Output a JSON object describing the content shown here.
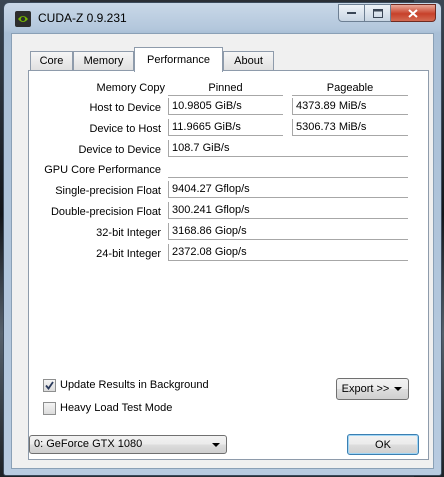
{
  "window": {
    "title": "CUDA-Z 0.9.231"
  },
  "tabs": [
    {
      "label": "Core"
    },
    {
      "label": "Memory"
    },
    {
      "label": "Performance"
    },
    {
      "label": "About"
    }
  ],
  "active_tab": "Performance",
  "memory": {
    "section_label": "Memory Copy",
    "col_pinned": "Pinned",
    "col_pageable": "Pageable",
    "rows": [
      {
        "label": "Host to Device",
        "pinned": "10.9805 GiB/s",
        "pageable": "4373.89 MiB/s"
      },
      {
        "label": "Device to Host",
        "pinned": "11.9665 GiB/s",
        "pageable": "5306.73 MiB/s"
      },
      {
        "label": "Device to Device",
        "pinned": "108.7 GiB/s"
      }
    ]
  },
  "gpu": {
    "section_label": "GPU Core Performance",
    "rows": [
      {
        "label": "Single-precision Float",
        "value": "9404.27 Gflop/s"
      },
      {
        "label": "Double-precision Float",
        "value": "300.241 Gflop/s"
      },
      {
        "label": "32-bit Integer",
        "value": "3168.86 Giop/s"
      },
      {
        "label": "24-bit Integer",
        "value": "2372.08 Giop/s"
      }
    ]
  },
  "options": {
    "update_background": {
      "label": "Update Results in Background",
      "checked": true
    },
    "heavy_load": {
      "label": "Heavy Load Test Mode",
      "checked": false
    }
  },
  "export_label": "Export >>",
  "device_select": {
    "value": "0: GeForce GTX 1080"
  },
  "ok_label": "OK",
  "icons": [
    "nvidia-logo-icon",
    "minimize-icon",
    "maximize-icon",
    "close-icon",
    "checkmark-icon",
    "dropdown-arrow-icon"
  ]
}
